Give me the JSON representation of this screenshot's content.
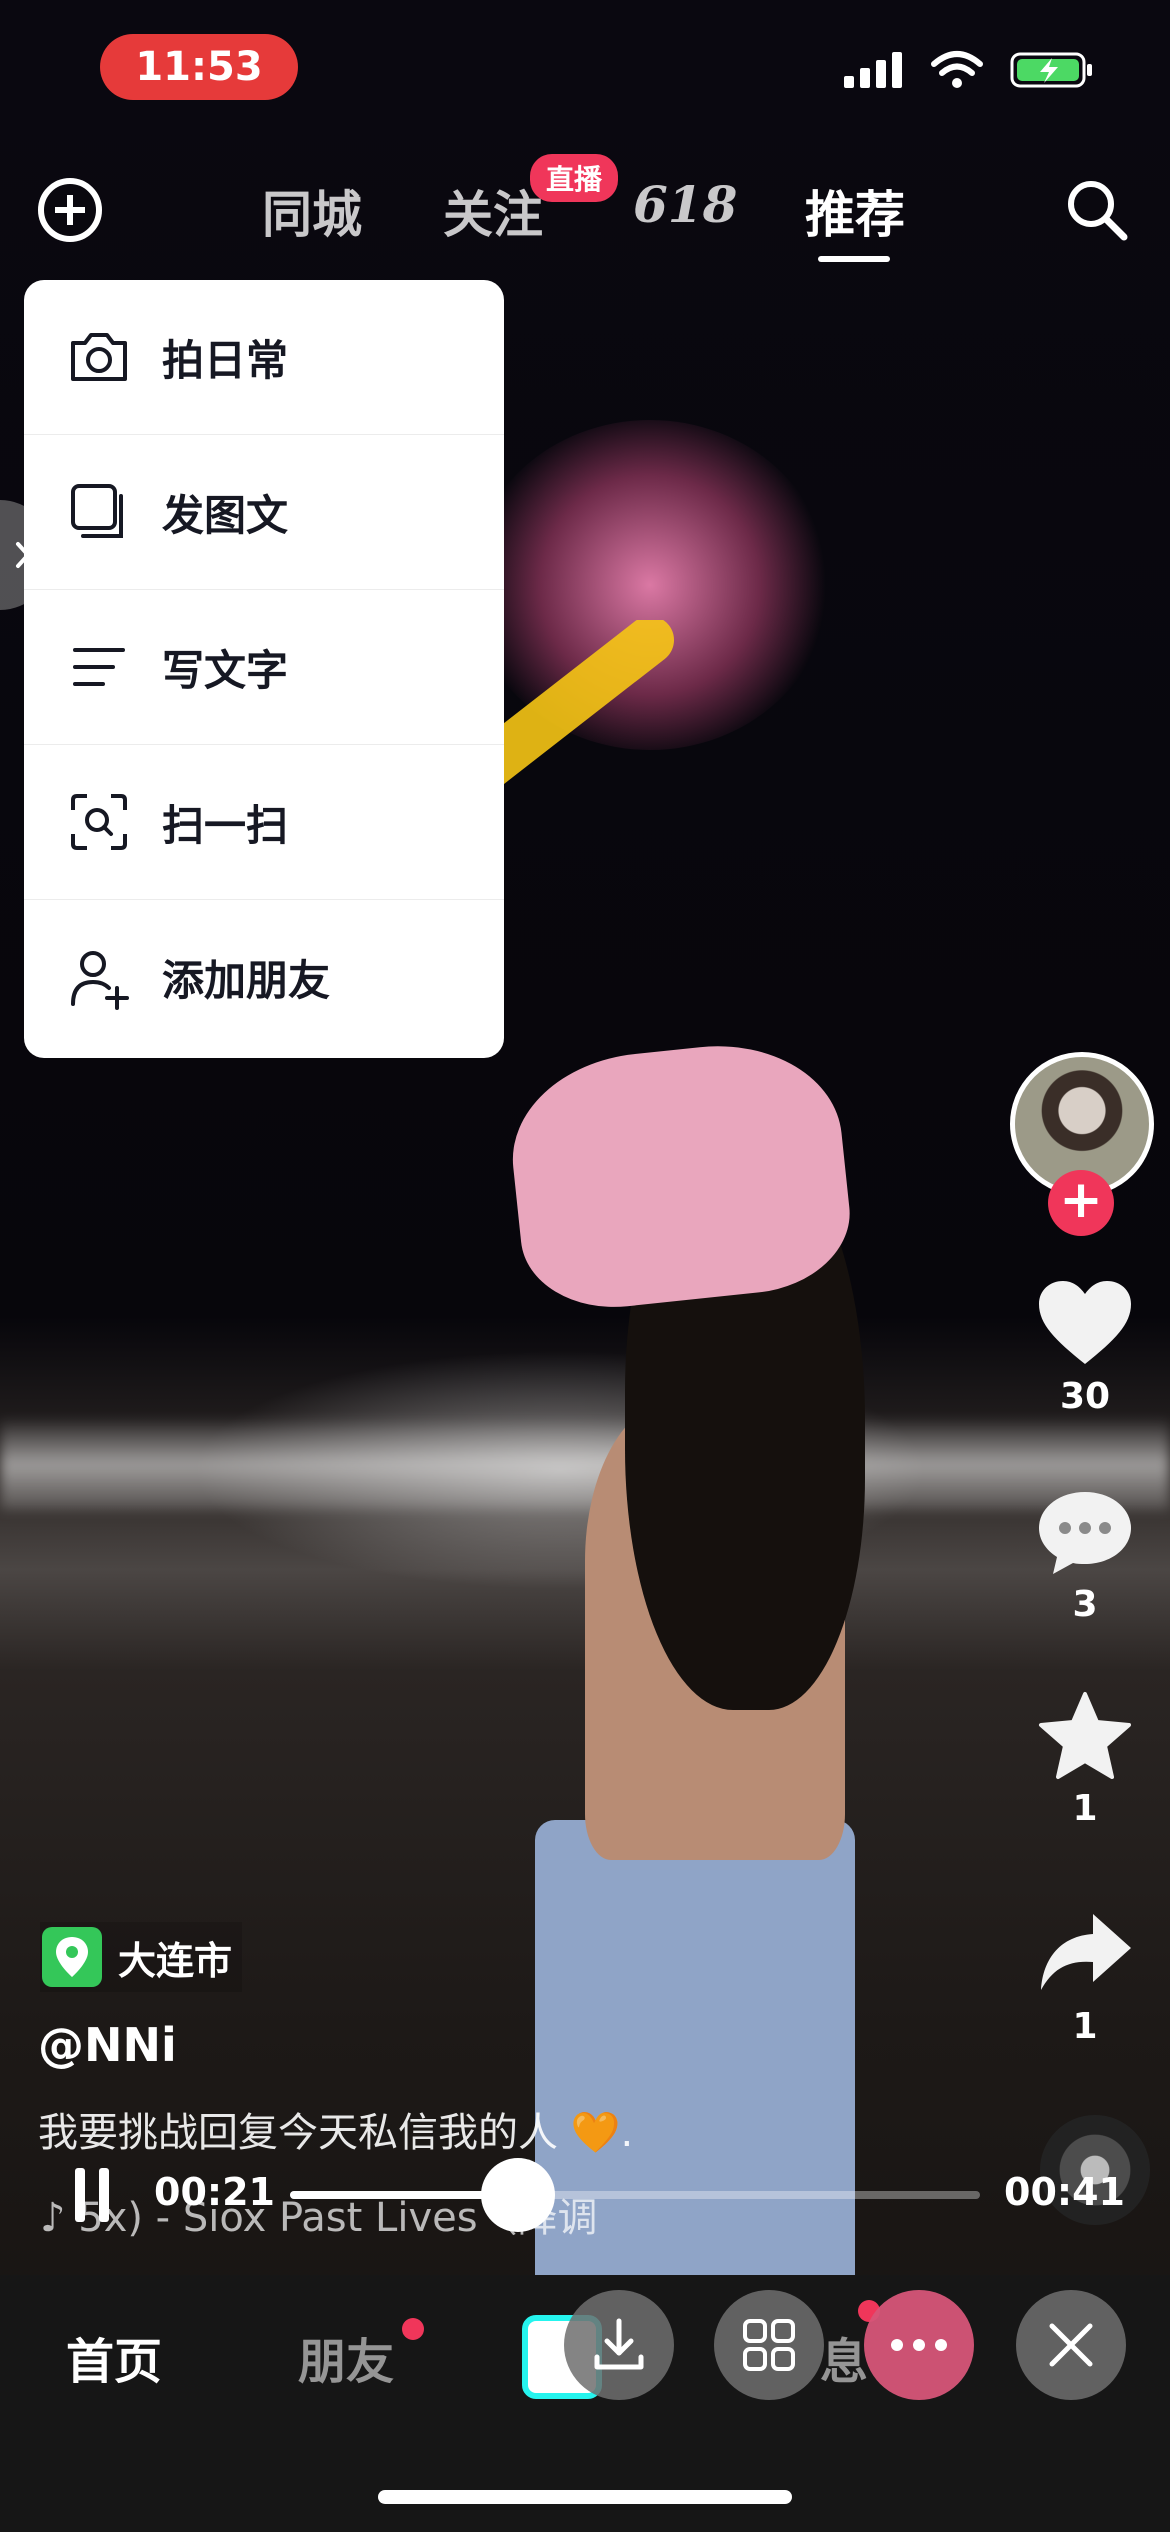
{
  "status_bar": {
    "time": "11:53"
  },
  "top_nav": {
    "tabs": [
      {
        "label": "同城"
      },
      {
        "label": "关注",
        "badge": "直播"
      },
      {
        "label": "618"
      },
      {
        "label": "推荐"
      }
    ]
  },
  "create_menu": {
    "items": [
      {
        "label": "拍日常",
        "icon": "camera-icon"
      },
      {
        "label": "发图文",
        "icon": "image-text-icon"
      },
      {
        "label": "写文字",
        "icon": "text-lines-icon"
      },
      {
        "label": "扫一扫",
        "icon": "scan-icon"
      },
      {
        "label": "添加朋友",
        "icon": "add-friend-icon"
      }
    ]
  },
  "actions": {
    "likes": "30",
    "comments": "3",
    "favorites": "1",
    "shares": "1"
  },
  "video": {
    "location": "大连市",
    "author": "@NNi",
    "description": "我要挑战回复今天私信我的人 🧡.",
    "music": "♪ 5x) - Siox   Past Lives（降调"
  },
  "player": {
    "current_time": "00:21",
    "total_time": "00:41",
    "progress": 0.33
  },
  "tab_bar": {
    "home": "首页",
    "friends": "朋友",
    "messages_partial": "息"
  },
  "colors": {
    "accent_red": "#f0365a",
    "highlight_yellow": "#f6c515",
    "time_pill": "#e63a3a"
  }
}
